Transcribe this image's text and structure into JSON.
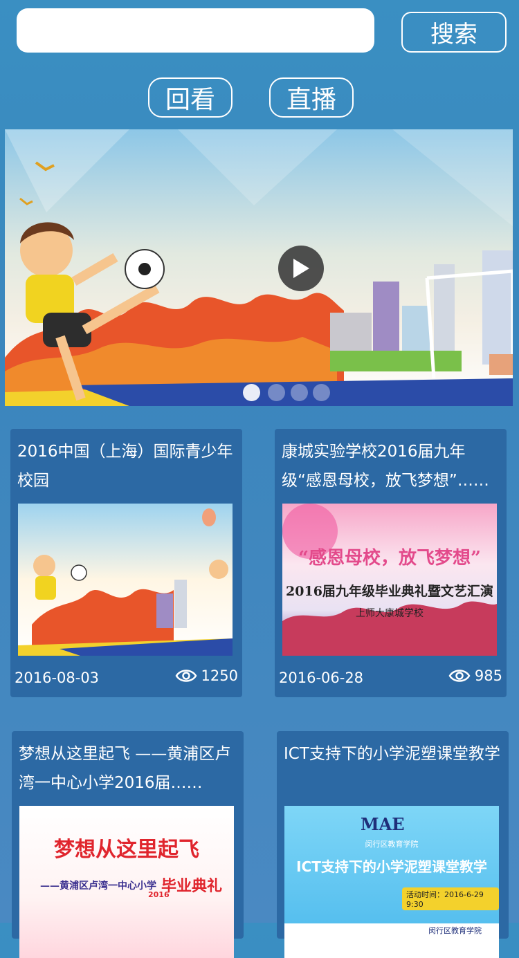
{
  "search": {
    "placeholder": "",
    "value": "",
    "button_label": "搜索"
  },
  "tabs": [
    {
      "label": "回看"
    },
    {
      "label": "直播"
    }
  ],
  "banner": {
    "slide_count": 4,
    "active_index": 0
  },
  "cards": [
    {
      "title": "2016中国（上海）国际青少年校园",
      "date": "2016-08-03",
      "views": "1250"
    },
    {
      "title": "康城实验学校2016届九年级“感恩母校，放飞梦想”……",
      "date": "2016-06-28",
      "views": "985",
      "thumb_text": {
        "line1": "“感恩母校，放飞梦想”",
        "line2": "2016届九年级毕业典礼暨文艺汇演",
        "line3": "上师大康城学校"
      }
    },
    {
      "title": "梦想从这里起飞 ——黄浦区卢湾一中心小学2016届……",
      "thumb_text": {
        "line1": "梦想从这里起飞",
        "line2": "——黄浦区卢湾一中心小学",
        "line3": "毕业典礼",
        "year": "2016"
      }
    },
    {
      "title": "ICT支持下的小学泥塑课堂教学",
      "thumb_text": {
        "logo": "MAE",
        "org": "闵行区教育学院",
        "headline": "ICT支持下的小学泥塑课堂教学",
        "time": "活动时间：2016-6-29 9:30",
        "footer": "闵行区教育学院"
      }
    }
  ]
}
